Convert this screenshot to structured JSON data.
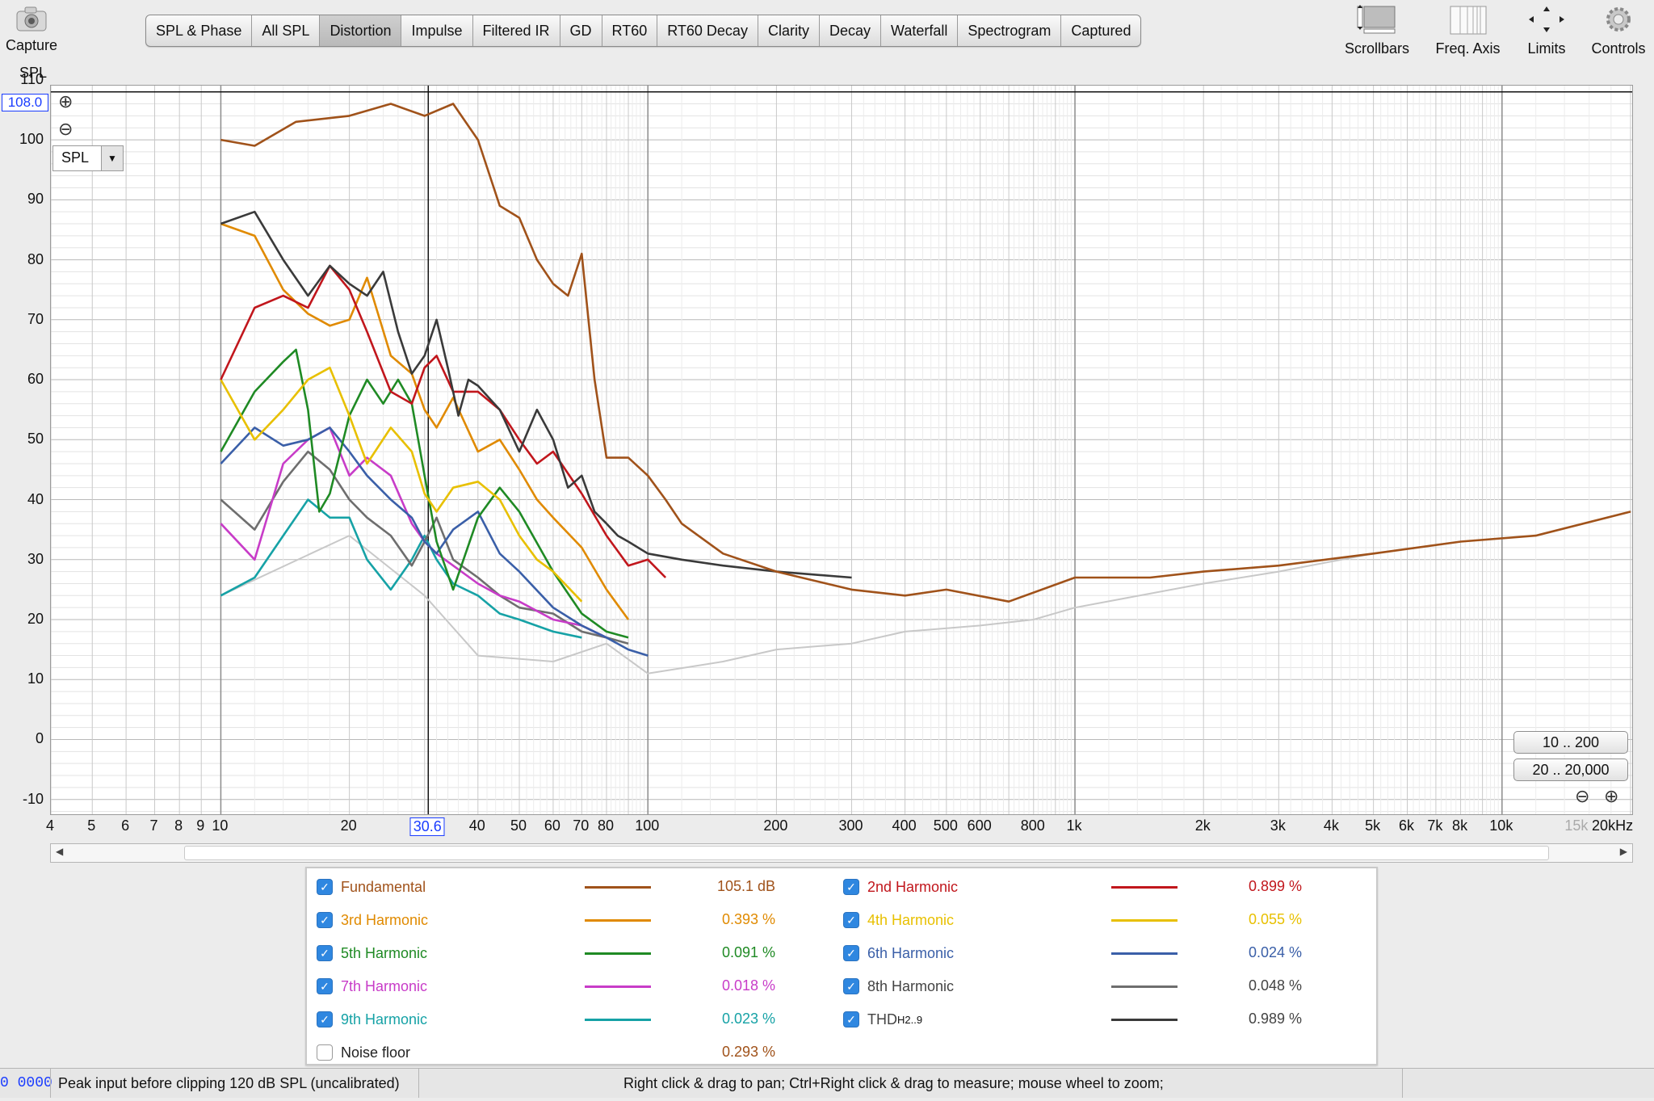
{
  "toolbar": {
    "capture_label": "Capture",
    "tabs": [
      "SPL & Phase",
      "All SPL",
      "Distortion",
      "Impulse",
      "Filtered IR",
      "GD",
      "RT60",
      "RT60 Decay",
      "Clarity",
      "Decay",
      "Waterfall",
      "Spectrogram",
      "Captured"
    ],
    "active_tab": "Distortion",
    "right_tools": [
      "Scrollbars",
      "Freq. Axis",
      "Limits",
      "Controls"
    ]
  },
  "plot": {
    "y_unit_label": "SPL",
    "y_cursor_value": "108.0",
    "x_cursor_value": "30.6",
    "y_ticks": [
      "110",
      "100",
      "90",
      "80",
      "70",
      "60",
      "50",
      "40",
      "30",
      "20",
      "10",
      "0",
      "-10"
    ],
    "x_ticks": [
      "4",
      "5",
      "6",
      "7",
      "8",
      "9",
      "10",
      "20",
      "30.6",
      "40",
      "50",
      "60",
      "70",
      "80",
      "100",
      "200",
      "300",
      "400",
      "500",
      "600",
      "800",
      "1k",
      "2k",
      "3k",
      "4k",
      "5k",
      "6k",
      "7k",
      "8k",
      "10k",
      "15k",
      "20kHz"
    ],
    "mode_select": "SPL",
    "range_buttons": [
      "10 .. 200",
      "20 .. 20,000"
    ]
  },
  "chart_data": {
    "type": "line",
    "xlabel": "",
    "ylabel": "SPL",
    "x_scale": "log",
    "xlim": [
      4,
      20000
    ],
    "ylim": [
      -13,
      112
    ],
    "grid": true,
    "series": [
      {
        "name": "Fundamental",
        "color": "#a0521a",
        "x": [
          10,
          12,
          15,
          20,
          25,
          30,
          35,
          40,
          45,
          50,
          55,
          60,
          65,
          70,
          75,
          80,
          90,
          100,
          110,
          120,
          150,
          200,
          300,
          400,
          500,
          700,
          1000,
          1500,
          2000,
          3000,
          5000,
          8000,
          12000,
          20000
        ],
        "y": [
          100,
          99,
          103,
          104,
          106,
          104,
          106,
          100,
          89,
          87,
          80,
          76,
          74,
          81,
          60,
          47,
          47,
          44,
          40,
          36,
          31,
          28,
          25,
          24,
          25,
          23,
          27,
          27,
          28,
          29,
          31,
          33,
          34,
          38
        ]
      },
      {
        "name": "2nd Harmonic",
        "color": "#c1161c",
        "x": [
          10,
          12,
          14,
          16,
          18,
          20,
          22,
          25,
          28,
          30,
          32,
          35,
          40,
          45,
          50,
          55,
          60,
          70,
          80,
          90,
          100,
          110
        ],
        "y": [
          60,
          72,
          74,
          72,
          79,
          75,
          68,
          58,
          56,
          62,
          64,
          58,
          58,
          55,
          50,
          46,
          48,
          41,
          34,
          29,
          30,
          27
        ]
      },
      {
        "name": "3rd Harmonic",
        "color": "#e08a00",
        "x": [
          10,
          12,
          14,
          16,
          18,
          20,
          22,
          25,
          28,
          30,
          32,
          35,
          40,
          45,
          50,
          55,
          60,
          70,
          80,
          90
        ],
        "y": [
          86,
          84,
          75,
          71,
          69,
          70,
          77,
          64,
          61,
          55,
          52,
          57,
          48,
          50,
          45,
          40,
          37,
          32,
          25,
          20
        ]
      },
      {
        "name": "4th Harmonic",
        "color": "#e8c000",
        "x": [
          10,
          12,
          14,
          16,
          18,
          20,
          22,
          25,
          28,
          30,
          32,
          35,
          40,
          45,
          50,
          55,
          60,
          70
        ],
        "y": [
          60,
          50,
          55,
          60,
          62,
          54,
          46,
          52,
          48,
          41,
          38,
          42,
          43,
          40,
          34,
          30,
          28,
          23
        ]
      },
      {
        "name": "5th Harmonic",
        "color": "#1f8a24",
        "x": [
          10,
          12,
          14,
          15,
          16,
          17,
          18,
          20,
          22,
          24,
          26,
          28,
          30,
          32,
          35,
          40,
          45,
          50,
          60,
          70,
          80,
          90
        ],
        "y": [
          48,
          58,
          63,
          65,
          55,
          38,
          41,
          54,
          60,
          56,
          60,
          56,
          44,
          33,
          25,
          37,
          42,
          38,
          28,
          21,
          18,
          17
        ]
      },
      {
        "name": "6th Harmonic",
        "color": "#3a5fa8",
        "x": [
          10,
          12,
          14,
          16,
          18,
          20,
          22,
          25,
          28,
          30,
          32,
          35,
          40,
          45,
          50,
          60,
          70,
          80,
          90,
          100
        ],
        "y": [
          46,
          52,
          49,
          50,
          52,
          48,
          44,
          40,
          37,
          33,
          31,
          35,
          38,
          31,
          28,
          22,
          19,
          17,
          15,
          14
        ]
      },
      {
        "name": "7th Harmonic",
        "color": "#c83cc8",
        "x": [
          10,
          12,
          14,
          16,
          18,
          20,
          22,
          25,
          28,
          30,
          32,
          35,
          40,
          45,
          50,
          60,
          70,
          80
        ],
        "y": [
          36,
          30,
          46,
          50,
          52,
          44,
          47,
          44,
          36,
          33,
          31,
          29,
          26,
          24,
          23,
          20,
          19,
          17
        ]
      },
      {
        "name": "8th Harmonic",
        "color": "#6e6e6e",
        "x": [
          10,
          12,
          14,
          16,
          18,
          20,
          22,
          25,
          28,
          30,
          32,
          35,
          40,
          45,
          50,
          60,
          70,
          80,
          90
        ],
        "y": [
          40,
          35,
          43,
          48,
          45,
          40,
          37,
          34,
          29,
          33,
          37,
          30,
          27,
          24,
          22,
          21,
          18,
          17,
          16
        ]
      },
      {
        "name": "9th Harmonic",
        "color": "#16a2a6",
        "x": [
          10,
          12,
          14,
          16,
          18,
          20,
          22,
          25,
          28,
          30,
          32,
          35,
          40,
          45,
          50,
          60,
          70
        ],
        "y": [
          24,
          27,
          34,
          40,
          37,
          37,
          30,
          25,
          30,
          34,
          30,
          26,
          24,
          21,
          20,
          18,
          17
        ]
      },
      {
        "name": "THD",
        "color": "#3a3a3a",
        "x": [
          10,
          12,
          14,
          16,
          18,
          20,
          22,
          24,
          26,
          28,
          30,
          32,
          34,
          36,
          38,
          40,
          45,
          50,
          55,
          60,
          65,
          70,
          75,
          80,
          85,
          90,
          100,
          120,
          150,
          200,
          300
        ],
        "y": [
          86,
          88,
          80,
          74,
          79,
          76,
          74,
          78,
          68,
          61,
          64,
          70,
          62,
          54,
          60,
          59,
          55,
          48,
          55,
          50,
          42,
          44,
          38,
          36,
          34,
          33,
          31,
          30,
          29,
          28,
          27
        ]
      },
      {
        "name": "Noise floor",
        "color": "#c8c8c8",
        "x": [
          10,
          20,
          30,
          40,
          60,
          80,
          100,
          150,
          200,
          300,
          400,
          600,
          800,
          1000,
          2000,
          3000,
          5000,
          8000
        ],
        "y": [
          24,
          34,
          24,
          14,
          13,
          16,
          11,
          13,
          15,
          16,
          18,
          19,
          20,
          22,
          26,
          28,
          31,
          33
        ]
      }
    ]
  },
  "legend": {
    "items": [
      {
        "label": "Fundamental",
        "value": "105.1 dB",
        "color": "#a0521a",
        "checked": true
      },
      {
        "label": "2nd Harmonic",
        "value": "0.899 %",
        "color": "#c1161c",
        "checked": true
      },
      {
        "label": "3rd Harmonic",
        "value": "0.393 %",
        "color": "#e08a00",
        "checked": true
      },
      {
        "label": "4th Harmonic",
        "value": "0.055 %",
        "color": "#e8c000",
        "checked": true
      },
      {
        "label": "5th Harmonic",
        "value": "0.091 %",
        "color": "#1f8a24",
        "checked": true
      },
      {
        "label": "6th Harmonic",
        "value": "0.024 %",
        "color": "#3a5fa8",
        "checked": true
      },
      {
        "label": "7th Harmonic",
        "value": "0.018 %",
        "color": "#c83cc8",
        "checked": true
      },
      {
        "label": "8th Harmonic",
        "value": "0.048 %",
        "color": "#6e6e6e",
        "checked": true
      },
      {
        "label": "9th Harmonic",
        "value": "0.023 %",
        "color": "#16a2a6",
        "checked": true
      },
      {
        "label": "THD",
        "label_sub": "H2..9",
        "value": "0.989 %",
        "color": "#3a3a3a",
        "checked": true
      },
      {
        "label": "Noise floor",
        "value": "0.293 %",
        "color": "#a0521a",
        "checked": false
      }
    ]
  },
  "status": {
    "counter": "0 0000",
    "peak": "Peak input before clipping 120 dB SPL (uncalibrated)",
    "hint": "Right click & drag to pan; Ctrl+Right click & drag to measure; mouse wheel to zoom;"
  }
}
